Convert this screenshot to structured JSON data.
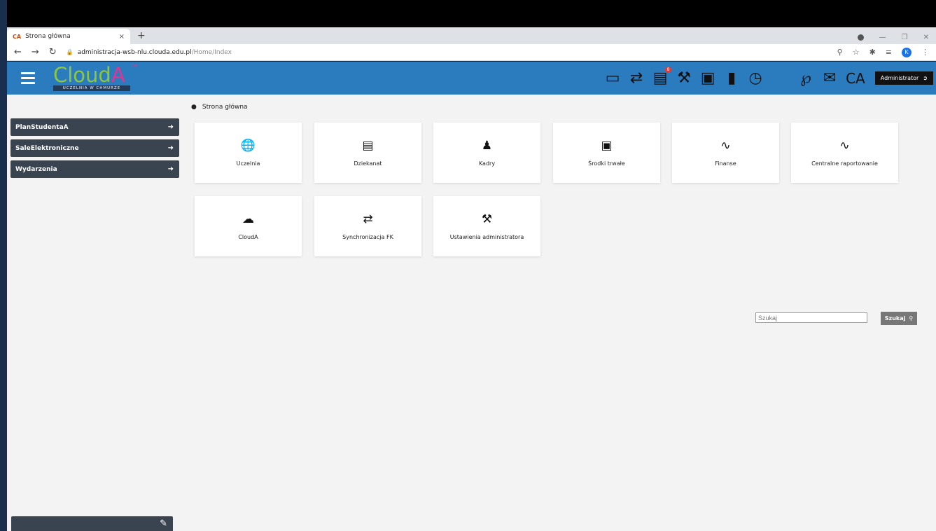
{
  "browser": {
    "tab_favicon": "CA",
    "tab_title": "Strona główna",
    "tab_close": "×",
    "new_tab": "+",
    "url_host": "administracja-wsb-nlu.clouda.edu.pl",
    "url_path": "/Home/Index",
    "avatar_letter": "K"
  },
  "header": {
    "logo_word_a": "Cloud",
    "logo_word_b": "A",
    "logo_tm": "TM",
    "logo_subtitle": "UCZELNIA W CHMURZE",
    "ca_label": "CA",
    "notification_count": "8",
    "admin_label": "Administrator"
  },
  "sidebar": {
    "items": [
      {
        "label": "PlanStudentaA"
      },
      {
        "label": "SaleElektroniczne"
      },
      {
        "label": "Wydarzenia"
      }
    ]
  },
  "breadcrumb": {
    "label": "Strona główna"
  },
  "tiles": [
    {
      "label": "Uczelnia",
      "icon": "globe-icon"
    },
    {
      "label": "Dziekanat",
      "icon": "id-card-icon"
    },
    {
      "label": "Kadry",
      "icon": "users-icon"
    },
    {
      "label": "Środki trwałe",
      "icon": "briefcase-icon"
    },
    {
      "label": "Finanse",
      "icon": "trend-icon"
    },
    {
      "label": "Centralne raportowanie",
      "icon": "trend-icon"
    },
    {
      "label": "CloudA",
      "icon": "cloud-icon"
    },
    {
      "label": "Synchronizacja FK",
      "icon": "shuffle-icon"
    },
    {
      "label": "Ustawienia administratora",
      "icon": "tools-icon"
    }
  ],
  "search": {
    "placeholder": "Szukaj",
    "button_label": "Szukaj"
  },
  "colors": {
    "header_bg": "#2b7bbf",
    "sidebar_bg": "#3a4350",
    "logo_green": "#8dc63f",
    "logo_pink": "#e2358f"
  }
}
